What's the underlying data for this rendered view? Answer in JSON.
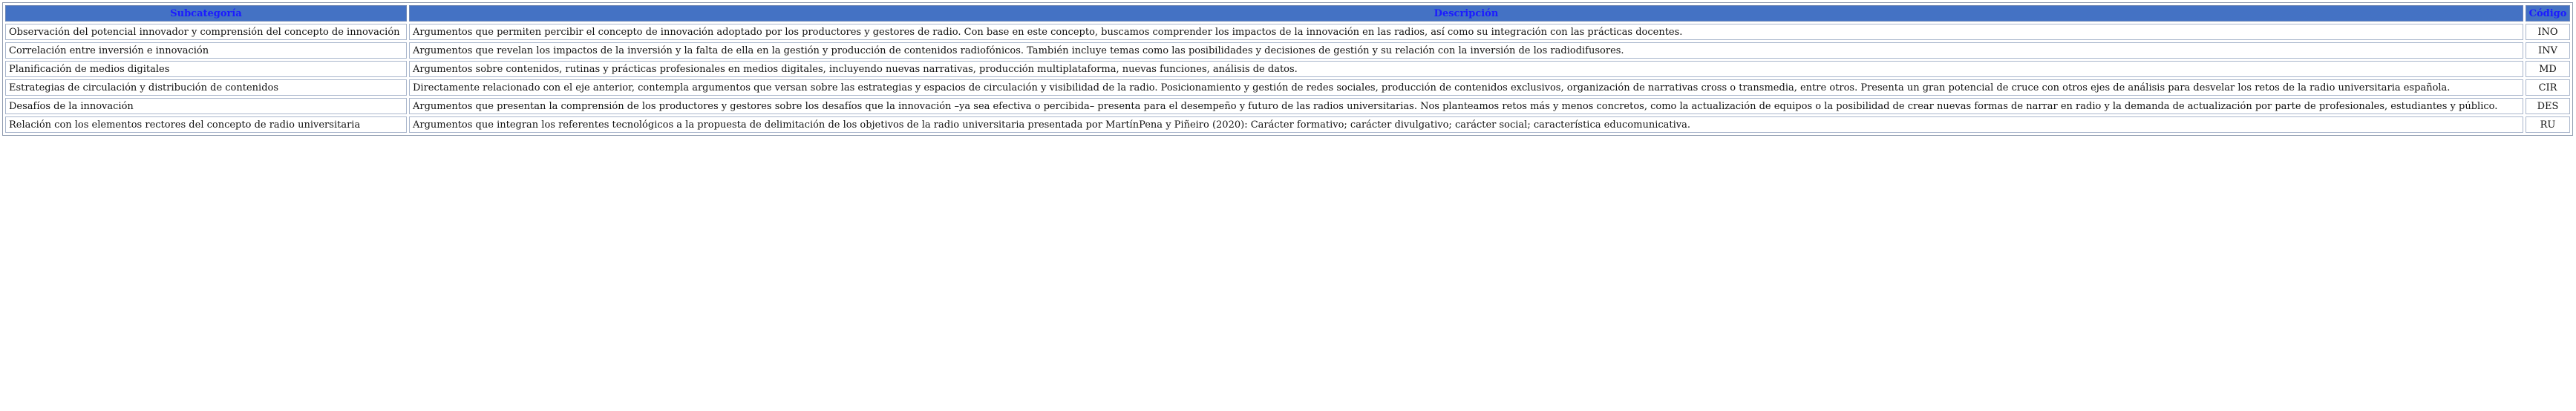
{
  "table": {
    "headers": {
      "subcategory": "Subcategoría",
      "description": "Descripción",
      "code": "Código"
    },
    "rows": [
      {
        "subcategory": "Observación del potencial innovador y comprensión del concepto de innovación",
        "description": "Argumentos que permiten percibir el concepto de innovación adoptado por los productores y gestores de radio. Con base en este concepto, buscamos comprender los impactos de la innovación en las radios, así como su integración con las prácticas docentes.",
        "code": "INO"
      },
      {
        "subcategory": "Correlación entre inversión e innovación",
        "description": "Argumentos que revelan los impactos de la inversión y la falta de ella en la gestión y producción de contenidos radiofónicos. También incluye temas como las posibilidades y decisiones de gestión y su relación con la inversión de los radiodifusores.",
        "code": "INV"
      },
      {
        "subcategory": "Planificación de medios digitales",
        "description": "Argumentos sobre contenidos, rutinas y prácticas profesionales en medios digitales, incluyendo nuevas narrativas, producción multiplataforma, nuevas funciones, análisis de datos.",
        "code": "MD"
      },
      {
        "subcategory": "Estrategias de circulación y distribución de contenidos",
        "description": "Directamente relacionado con el eje anterior, contempla argumentos que versan sobre las estrategias y espacios de circulación y visibilidad de la radio. Posicionamiento y gestión de redes sociales, producción de contenidos exclusivos, organización de narrativas cross o transmedia, entre otros. Presenta un gran potencial de cruce con otros ejes de análisis para desvelar los retos de la radio universitaria española.",
        "code": "CIR"
      },
      {
        "subcategory": "Desafíos de la innovación",
        "description": "Argumentos que presentan la comprensión de los productores y gestores sobre los desafíos que la innovación –ya sea efectiva o percibida– presenta para el desempeño y futuro de las radios universitarias. Nos planteamos retos más y menos concretos, como la actualización de equipos o la posibilidad de crear nuevas formas de narrar en radio y la demanda de actualización por parte de profesionales, estudiantes y público.",
        "code": "DES"
      },
      {
        "subcategory": "Relación con los elementos rectores del concepto de radio universitaria",
        "description": "Argumentos que integran los referentes tecnológicos a la propuesta de delimitación de los objetivos de la radio universitaria presentada por MartínPena y Piñeiro (2020): Carácter formativo; carácter divulgativo; carácter social; característica educomunicativa.",
        "code": "RU"
      }
    ]
  }
}
